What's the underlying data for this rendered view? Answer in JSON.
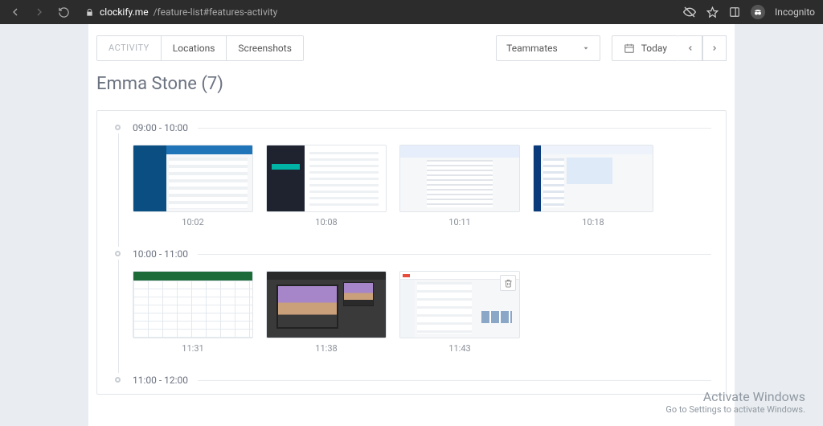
{
  "browser": {
    "url_domain": "clockify.me",
    "url_path": "/feature-list#features-activity",
    "incognito_label": "Incognito"
  },
  "tabs": {
    "activity": "ACTIVITY",
    "locations": "Locations",
    "screenshots": "Screenshots"
  },
  "dropdowns": {
    "teammates": "Teammates",
    "date_label": "Today"
  },
  "user_title": "Emma Stone (7)",
  "blocks": [
    {
      "range": "09:00 - 10:00",
      "shots": [
        {
          "time": "10:02",
          "art": "bluepanel"
        },
        {
          "time": "10:08",
          "art": "darkpanel"
        },
        {
          "time": "10:11",
          "art": "doc"
        },
        {
          "time": "10:18",
          "art": "outlook"
        }
      ]
    },
    {
      "range": "10:00 - 11:00",
      "shots": [
        {
          "time": "11:31",
          "art": "excel"
        },
        {
          "time": "11:38",
          "art": "photoshop"
        },
        {
          "time": "11:43",
          "art": "gmail",
          "deletable": true
        }
      ]
    },
    {
      "range": "11:00 - 12:00",
      "shots": []
    }
  ],
  "watermark": {
    "line1": "Activate Windows",
    "line2": "Go to Settings to activate Windows."
  }
}
